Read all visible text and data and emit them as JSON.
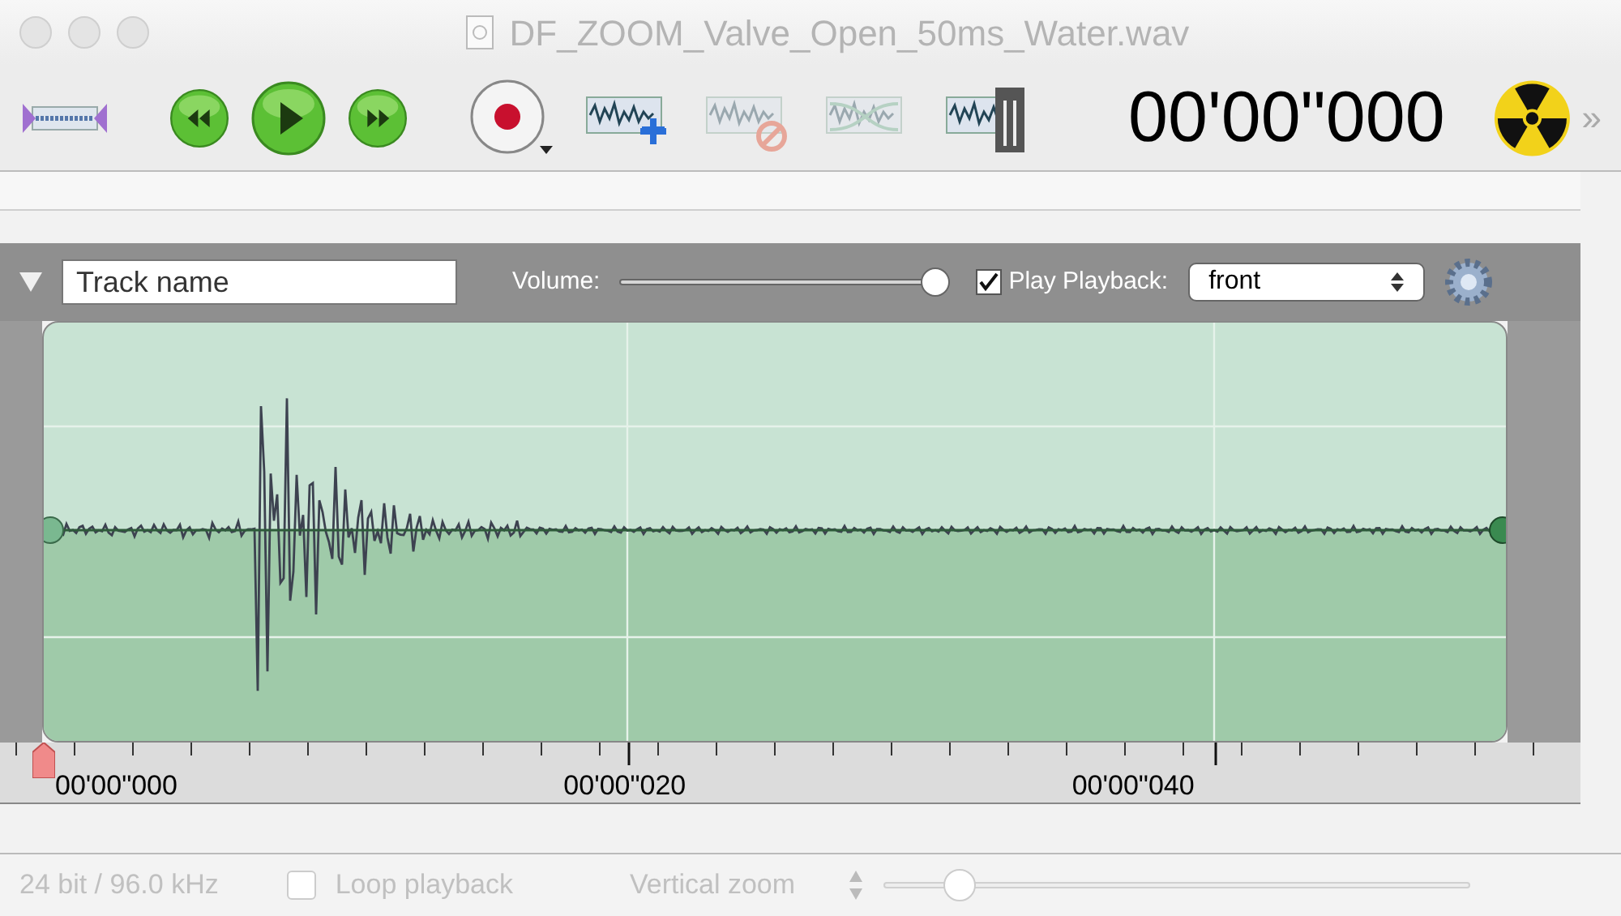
{
  "window": {
    "title": "DF_ZOOM_Valve_Open_50ms_Water.wav"
  },
  "toolbar": {
    "buttons": [
      {
        "kind": "fit",
        "disabled": false
      },
      {
        "kind": "rewind",
        "disabled": false
      },
      {
        "kind": "play",
        "disabled": false
      },
      {
        "kind": "forward",
        "disabled": false
      },
      {
        "kind": "record",
        "disabled": false
      },
      {
        "kind": "add",
        "disabled": false
      },
      {
        "kind": "delete",
        "disabled": true
      },
      {
        "kind": "crossfade",
        "disabled": true
      },
      {
        "kind": "split",
        "disabled": false
      }
    ],
    "time": "00'00\"000",
    "more": "»"
  },
  "track": {
    "name": "Track name",
    "volume_label": "Volume:",
    "volume": {
      "level": 1
    },
    "play_playback": {
      "label": "Play Playback:",
      "checked": true
    },
    "output": {
      "value": "front"
    }
  },
  "timeline": {
    "labels": [
      "00'00\"000",
      "00'00\"020",
      "00'00\"040"
    ]
  },
  "status_bar": {
    "format": "24 bit / 96.0 kHz",
    "loop_playback": {
      "label": "Loop playback",
      "checked": false
    },
    "vertical_zoom_label": "Vertical zoom",
    "vertical_zoom": {
      "level": 0.13
    }
  }
}
